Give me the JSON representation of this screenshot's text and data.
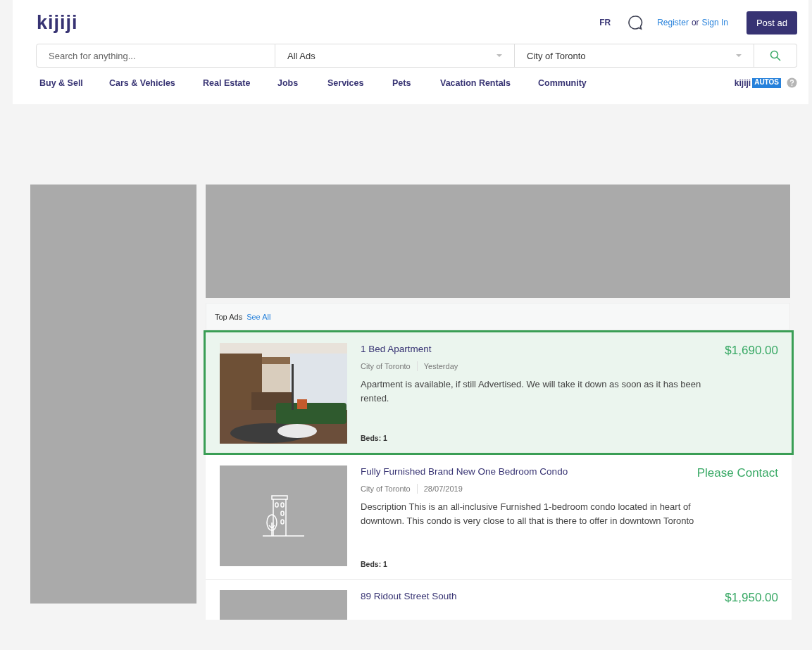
{
  "header": {
    "logo": "kijiji",
    "language": "FR",
    "register": "Register",
    "or": "or",
    "sign_in": "Sign In",
    "post_ad": "Post ad"
  },
  "search": {
    "placeholder": "Search for anything...",
    "category": "All Ads",
    "location": "City of Toronto"
  },
  "nav": [
    "Buy & Sell",
    "Cars & Vehicles",
    "Real Estate",
    "Jobs",
    "Services",
    "Pets",
    "Vacation Rentals",
    "Community"
  ],
  "autos_logo": {
    "brand": "kijiji",
    "badge": "AUTOS"
  },
  "top_ads": {
    "label": "Top Ads",
    "link": "See All"
  },
  "listings": [
    {
      "title": "1 Bed Apartment",
      "price": "$1,690.00",
      "location": "City of Toronto",
      "date": "Yesterday",
      "description": "Apartment is available, if still Advertised. We will take it down as soon as it has been rented.",
      "beds_label": "Beds:",
      "beds": "1",
      "highlighted": true,
      "kind": "picture"
    },
    {
      "title": "Fully Furnished Brand New One Bedroom Condo",
      "price": "Please Contact",
      "location": "City of Toronto",
      "date": "28/07/2019",
      "description": "Description This is an all-inclusive Furnished 1-bedroom condo located in heart of downtown. This condo is very close to all that is there to offer in downtown Toronto",
      "beds_label": "Beds:",
      "beds": "1",
      "highlighted": false,
      "kind": "building"
    },
    {
      "title": "89 Ridout Street South",
      "price": "$1,950.00",
      "highlighted": false,
      "kind": "blank"
    }
  ]
}
